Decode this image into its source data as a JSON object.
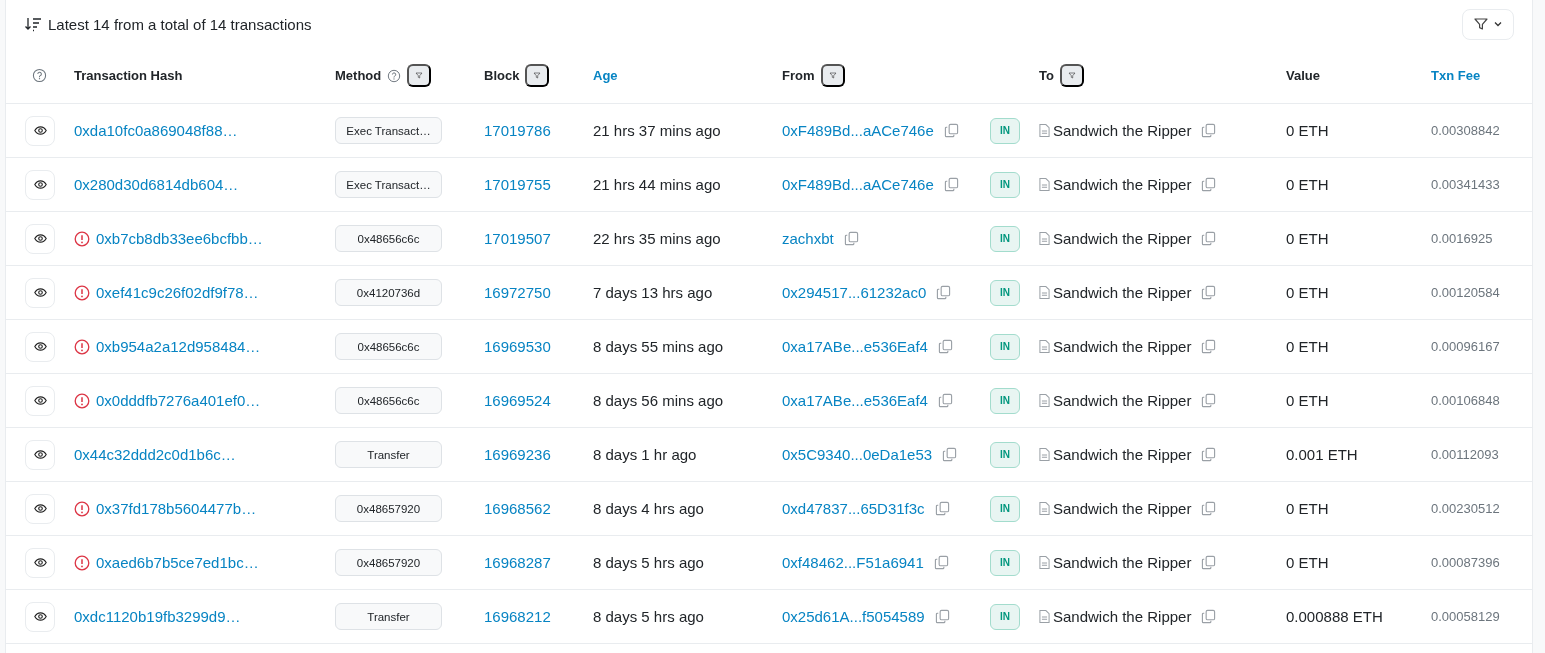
{
  "summary": "Latest 14 from a total of 14 transactions",
  "columns": [
    {
      "label": "Transaction Hash",
      "help": false,
      "filter": false,
      "link": false
    },
    {
      "label": "Method",
      "help": true,
      "filter": true,
      "link": false
    },
    {
      "label": "Block",
      "help": false,
      "filter": true,
      "link": false
    },
    {
      "label": "Age",
      "help": false,
      "filter": false,
      "link": true
    },
    {
      "label": "From",
      "help": false,
      "filter": true,
      "link": false
    },
    {
      "label": "To",
      "help": false,
      "filter": true,
      "link": false
    },
    {
      "label": "Value",
      "help": false,
      "filter": false,
      "link": false
    },
    {
      "label": "Txn Fee",
      "help": false,
      "filter": false,
      "link": true
    }
  ],
  "rows": [
    {
      "failed": false,
      "hash": "0xda10fc0a869048f88…",
      "method": "Exec Transact…",
      "block": "17019786",
      "age": "21 hrs 37 mins ago",
      "from": "0xF489Bd...aACe746e",
      "direction": "IN",
      "to": "Sandwich the Ripper",
      "value": "0 ETH",
      "fee": "0.00308842"
    },
    {
      "failed": false,
      "hash": "0x280d30d6814db604…",
      "method": "Exec Transact…",
      "block": "17019755",
      "age": "21 hrs 44 mins ago",
      "from": "0xF489Bd...aACe746e",
      "direction": "IN",
      "to": "Sandwich the Ripper",
      "value": "0 ETH",
      "fee": "0.00341433"
    },
    {
      "failed": true,
      "hash": "0xb7cb8db33ee6bcfbb…",
      "method": "0x48656c6c",
      "block": "17019507",
      "age": "22 hrs 35 mins ago",
      "from": "zachxbt",
      "direction": "IN",
      "to": "Sandwich the Ripper",
      "value": "0 ETH",
      "fee": "0.0016925"
    },
    {
      "failed": true,
      "hash": "0xef41c9c26f02df9f78…",
      "method": "0x4120736d",
      "block": "16972750",
      "age": "7 days 13 hrs ago",
      "from": "0x294517...61232ac0",
      "direction": "IN",
      "to": "Sandwich the Ripper",
      "value": "0 ETH",
      "fee": "0.00120584"
    },
    {
      "failed": true,
      "hash": "0xb954a2a12d958484…",
      "method": "0x48656c6c",
      "block": "16969530",
      "age": "8 days 55 mins ago",
      "from": "0xa17ABe...e536Eaf4",
      "direction": "IN",
      "to": "Sandwich the Ripper",
      "value": "0 ETH",
      "fee": "0.00096167"
    },
    {
      "failed": true,
      "hash": "0x0dddfb7276a401ef0…",
      "method": "0x48656c6c",
      "block": "16969524",
      "age": "8 days 56 mins ago",
      "from": "0xa17ABe...e536Eaf4",
      "direction": "IN",
      "to": "Sandwich the Ripper",
      "value": "0 ETH",
      "fee": "0.00106848"
    },
    {
      "failed": false,
      "hash": "0x44c32ddd2c0d1b6c…",
      "method": "Transfer",
      "block": "16969236",
      "age": "8 days 1 hr ago",
      "from": "0x5C9340...0eDa1e53",
      "direction": "IN",
      "to": "Sandwich the Ripper",
      "value": "0.001 ETH",
      "fee": "0.00112093"
    },
    {
      "failed": true,
      "hash": "0x37fd178b5604477b…",
      "method": "0x48657920",
      "block": "16968562",
      "age": "8 days 4 hrs ago",
      "from": "0xd47837...65D31f3c",
      "direction": "IN",
      "to": "Sandwich the Ripper",
      "value": "0 ETH",
      "fee": "0.00230512"
    },
    {
      "failed": true,
      "hash": "0xaed6b7b5ce7ed1bc…",
      "method": "0x48657920",
      "block": "16968287",
      "age": "8 days 5 hrs ago",
      "from": "0xf48462...F51a6941",
      "direction": "IN",
      "to": "Sandwich the Ripper",
      "value": "0 ETH",
      "fee": "0.00087396"
    },
    {
      "failed": false,
      "hash": "0xdc1120b19fb3299d9…",
      "method": "Transfer",
      "block": "16968212",
      "age": "8 days 5 hrs ago",
      "from": "0x25d61A...f5054589",
      "direction": "IN",
      "to": "Sandwich the Ripper",
      "value": "0.000888 ETH",
      "fee": "0.00058129"
    }
  ]
}
